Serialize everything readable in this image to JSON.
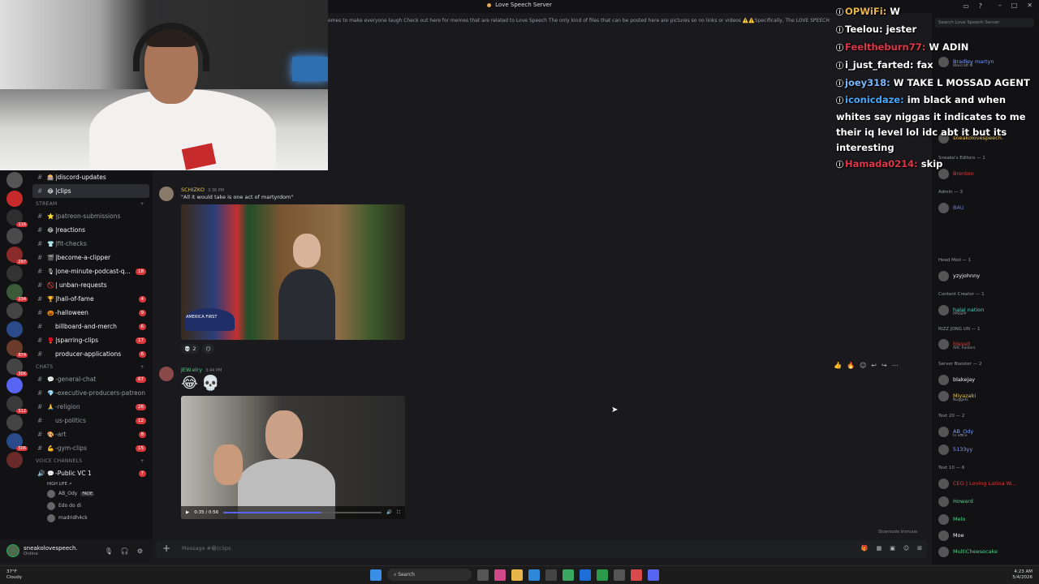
{
  "window": {
    "title": "Love Speech Server"
  },
  "topic": "emes to make everyone laugh Check out here for memes that are related to Love Speech The only kind of files that can be posted here are pictures so no links or videos ⚠️⚠️Specifically, The LOVE SPEECH Server DOES",
  "rail": {
    "badges": [
      "",
      "",
      "116",
      "",
      "297",
      "",
      "234",
      "",
      "",
      "874",
      "30K",
      "",
      "512",
      "",
      "506",
      ""
    ]
  },
  "channels": {
    "items": [
      {
        "label": "|discord-updates",
        "emoji": "🎰",
        "bright": true
      },
      {
        "label": "|clips",
        "emoji": "😂",
        "active": true
      }
    ],
    "stream_label": "STREAM",
    "stream": [
      {
        "label": "|patreon-submissions",
        "emoji": "⭐",
        "count": ""
      },
      {
        "label": "|reactions",
        "emoji": "😂",
        "count": "",
        "bright": true
      },
      {
        "label": "|fit-checks",
        "emoji": "👕",
        "count": ""
      },
      {
        "label": "|become-a-clipper",
        "emoji": "🎬",
        "count": "",
        "bright": true
      },
      {
        "label": "|one-minute-podcast-q...",
        "emoji": "🎙",
        "count": "18",
        "bright": true
      },
      {
        "label": "| unban-requests",
        "emoji": "🚫",
        "count": "",
        "bright": true
      },
      {
        "label": "|hall-of-fame",
        "emoji": "🏆",
        "count": "4",
        "bright": true
      },
      {
        "label": "-halloween",
        "emoji": "🎃",
        "count": "9",
        "bright": true
      },
      {
        "label": "billboard-and-merch",
        "emoji": "",
        "count": "6",
        "bright": true
      },
      {
        "label": "|sparring-clips",
        "emoji": "🥊",
        "count": "17",
        "bright": true
      },
      {
        "label": "producer-applications",
        "emoji": "",
        "count": "6",
        "bright": true
      }
    ],
    "chats_label": "CHATS",
    "chats": [
      {
        "label": "-general-chat",
        "emoji": "💬",
        "count": "67"
      },
      {
        "label": "-executive-producers-patreon",
        "emoji": "💎",
        "count": ""
      },
      {
        "label": "-religion",
        "emoji": "🙏",
        "count": "26"
      },
      {
        "label": "us-politics",
        "emoji": "",
        "count": "12"
      },
      {
        "label": "-art",
        "emoji": "🎨",
        "count": "8"
      },
      {
        "label": "-gym-clips",
        "emoji": "💪",
        "count": "15"
      }
    ],
    "voice_label": "VOICE CHANNELS",
    "voice_channel": "-Public VC 1",
    "voice_channel_count": "7",
    "voice_sub": "HIGH LIFE ↗",
    "voice_users": [
      {
        "name": "AB_Ody",
        "tag": "FADE"
      },
      {
        "name": "Edo do di",
        "tag": ""
      },
      {
        "name": "madridh4ck",
        "tag": ""
      }
    ]
  },
  "userpanel": {
    "name": "sneakolovespeech.",
    "status": "Online"
  },
  "messages": [
    {
      "author": "SCHIZKO",
      "time": "3:36 PM",
      "text": "\"All it would take is one act of martyrdom\"",
      "image_label": "AMERICA FIRST",
      "reactions": [
        {
          "emoji": "💀",
          "count": "2"
        },
        {
          "emoji": "😶",
          "count": ""
        }
      ]
    },
    {
      "author": "JEW.elry",
      "time": "3:44 PM",
      "emojis": "😂💀",
      "video_time": "0:35 / 0:56"
    }
  ],
  "video_progress": 0.62,
  "composer": {
    "placeholder": "Message #😂|clips",
    "slowmode": "Slowmode Immune"
  },
  "members": {
    "search_placeholder": "Search Love Speech Server",
    "sections": [
      {
        "label": "Sneako's Editors — 1"
      },
      {
        "label": "Admin — 3"
      },
      {
        "label": "Head Mod — 1"
      },
      {
        "label": "Content Creator — 1"
      },
      {
        "label": "RIZZ JONG UN — 1"
      },
      {
        "label": "Server Booster — 2"
      },
      {
        "label": "Text 20 — 2"
      },
      {
        "label": "Text 10 — 6"
      }
    ],
    "rows": [
      {
        "name": "Bradley martyn",
        "sub": "Warcraft III",
        "color": "#7a9cff"
      },
      {
        "name": "sneakolovespeech.",
        "sub": "",
        "color": "#e8c24a"
      },
      {
        "name": "Brenton",
        "sub": "",
        "color": "#d83c3e"
      },
      {
        "name": "BAU",
        "sub": "",
        "color": "#6b7bd6"
      },
      {
        "name": "yzyjohnny",
        "sub": "",
        "color": "#f2f3f5"
      },
      {
        "name": "halal nation",
        "sub": "PPSSPP",
        "color": "#4fd0c0"
      },
      {
        "name": "blessd",
        "sub": "ARC Raiders",
        "color": "#d83c3e"
      },
      {
        "name": "blakejay",
        "sub": "",
        "color": "#f2f3f5"
      },
      {
        "name": "Miyazaki",
        "sub": "Nuggets",
        "color": "#e8c24a"
      },
      {
        "name": "AB_Ody",
        "sub": "In voice",
        "color": "#7a9cff"
      },
      {
        "name": "5133yy",
        "sub": "",
        "color": "#7a9cff"
      },
      {
        "name": "CEO | Loving Latina W...",
        "sub": "",
        "color": "#d83c3e"
      },
      {
        "name": "Howard",
        "sub": "",
        "color": "#4fd08a"
      },
      {
        "name": "Melo",
        "sub": "",
        "color": "#4fd08a"
      },
      {
        "name": "Moe",
        "sub": "",
        "color": "#f2f3f5"
      },
      {
        "name": "MultiCheesecake",
        "sub": "",
        "color": "#4fd08a"
      }
    ]
  },
  "stream_chat": [
    {
      "user": "OPWiFi:",
      "color": "#e8b54a",
      "text": "W"
    },
    {
      "user": "Teelou:",
      "color": "#ffffff",
      "text": "jester"
    },
    {
      "user": "Feeltheburn77:",
      "color": "#e0364a",
      "text": "W ADIN"
    },
    {
      "user": "i_just_farted:",
      "color": "#ffffff",
      "text": "fax"
    },
    {
      "user": "joey318:",
      "color": "#7ab8ff",
      "text": "W TAKE L MOSSAD AGENT"
    },
    {
      "user": "iconicdaze:",
      "color": "#4aa8ff",
      "text": "im black and when whites say niggas it indicates to me their iq level lol idc abt it but its interesting"
    },
    {
      "user": "Hamada0214:",
      "color": "#e0364a",
      "text": "skip"
    }
  ],
  "taskbar": {
    "weather_temp": "37°F",
    "weather_desc": "Cloudy",
    "search": "Search",
    "time": "4:23 AM",
    "date": "5/4/2026"
  },
  "colors": {
    "accent": "#5865f2",
    "badge": "#da373c",
    "online": "#23a55a"
  }
}
